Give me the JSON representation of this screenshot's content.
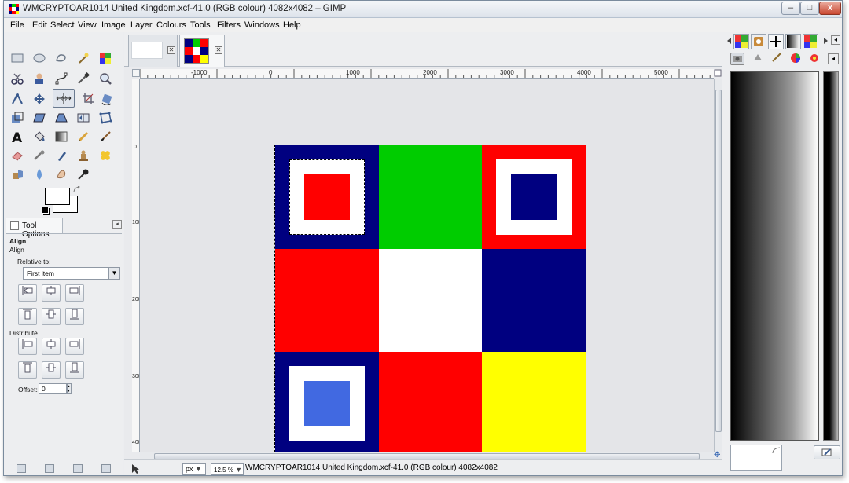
{
  "window": {
    "title": "WMCRYPTOAR1014 United Kingdom.xcf-41.0 (RGB colour) 4082x4082 – GIMP",
    "min_glyph": "–",
    "max_glyph": "□",
    "close_glyph": "x"
  },
  "menu": [
    "File",
    "Edit",
    "Select",
    "View",
    "Image",
    "Layer",
    "Colours",
    "Tools",
    "Filters",
    "Windows",
    "Help"
  ],
  "tool_options": {
    "tab_label": "Tool Options",
    "heading": "Align",
    "subheading": "Align",
    "relative_to_label": "Relative to:",
    "relative_to_value": "First item",
    "distribute_label": "Distribute",
    "offset_label": "Offset:",
    "offset_value": "0"
  },
  "rulers": {
    "h_labels": [
      "-1000",
      "0",
      "1000",
      "2000",
      "3000",
      "4000",
      "5000"
    ],
    "v_labels": [
      "0",
      "1000",
      "2000",
      "3000",
      "4000"
    ]
  },
  "statusbar": {
    "unit": "px",
    "zoom": "12.5 %",
    "text": "WMCRYPTOAR1014 United Kingdom.xcf-41.0 (RGB colour) 4082x4082"
  },
  "picture": {
    "colors": {
      "navy": "#000080",
      "green": "#00cc00",
      "red": "#ff0000",
      "white": "#ffffff",
      "yellow": "#ffff00",
      "royal_blue": "#4169e1"
    },
    "cells": [
      {
        "bg": "navy",
        "frame": true,
        "inner": "red",
        "selected": true
      },
      {
        "bg": "green",
        "frame": false
      },
      {
        "bg": "red",
        "frame": true,
        "inner": "navy"
      },
      {
        "bg": "red",
        "frame": false
      },
      {
        "bg": "white",
        "frame": false
      },
      {
        "bg": "navy",
        "frame": false
      },
      {
        "bg": "navy",
        "frame": true,
        "inner": "royal_blue"
      },
      {
        "bg": "red",
        "frame": false
      },
      {
        "bg": "yellow",
        "frame": false
      }
    ]
  },
  "dock": {
    "tab_icons": [
      "pattern-icon",
      "brush-icon",
      "line-icon",
      "gradient-icon",
      "palette-icon"
    ],
    "sub_icons": [
      "layers-icon",
      "channels-icon",
      "paths-icon",
      "colormap-icon",
      "undo-icon"
    ]
  },
  "icons": {
    "expand_menu": "◂",
    "dropdown_arrow": "▼"
  }
}
